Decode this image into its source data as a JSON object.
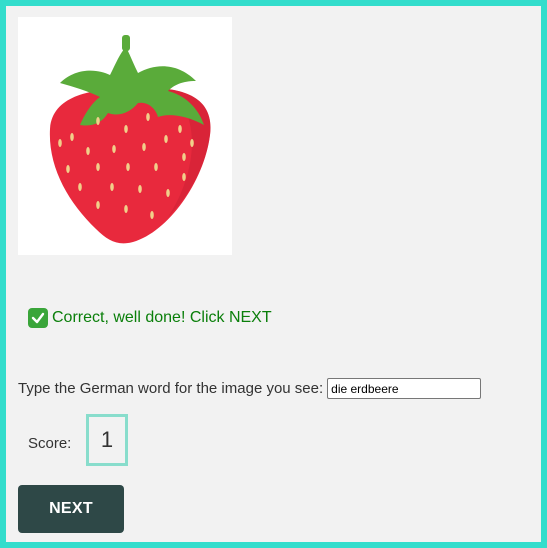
{
  "image": {
    "icon": "strawberry-image",
    "colors": {
      "berry": "#e8293d",
      "leaves": "#5aab3a",
      "seeds": "#f1cf8a"
    }
  },
  "feedback": {
    "icon": "check-icon",
    "text": "Correct, well done! Click NEXT",
    "color": "#0a7f0a"
  },
  "prompt": {
    "label": "Type the German word for the image you see:",
    "input_value": "die erdbeere"
  },
  "score": {
    "label": "Score:",
    "value": "1"
  },
  "next_button": {
    "label": "NEXT"
  },
  "colors": {
    "frame": "#33ddcc",
    "button": "#2e4847",
    "score_border": "#88ddcc"
  }
}
